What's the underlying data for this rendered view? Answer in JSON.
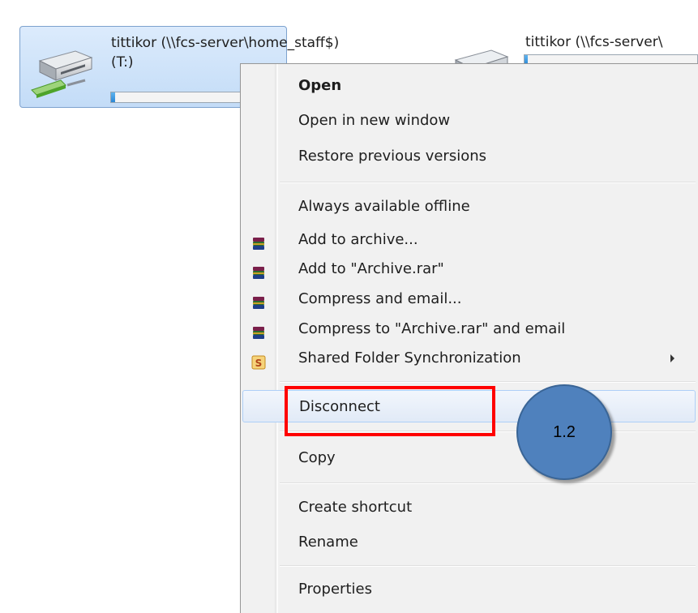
{
  "drives": [
    {
      "name": "tittikor (\\\\fcs-server\\home_staff$)",
      "letter": "(T:)",
      "selected": true,
      "capacity_used_fraction": 0.02
    },
    {
      "name": "tittikor (\\\\fcs-server\\",
      "letter": "",
      "selected": false,
      "capacity_used_fraction": 0.02
    }
  ],
  "context_menu": {
    "items": [
      {
        "label": "Open",
        "bold": true
      },
      {
        "label": "Open in new window"
      },
      {
        "label": "Restore previous versions"
      },
      {
        "label": "Always available offline"
      },
      {
        "label": "Add to archive...",
        "icon": "winrar-icon"
      },
      {
        "label": "Add to \"Archive.rar\"",
        "icon": "winrar-icon"
      },
      {
        "label": "Compress and email...",
        "icon": "winrar-icon"
      },
      {
        "label": "Compress to \"Archive.rar\" and email",
        "icon": "winrar-icon"
      },
      {
        "label": "Shared Folder Synchronization",
        "icon": "sync-icon",
        "submenu": true
      },
      {
        "label": "Disconnect",
        "hover": true
      },
      {
        "label": "Copy"
      },
      {
        "label": "Create shortcut"
      },
      {
        "label": "Rename"
      },
      {
        "label": "Properties"
      }
    ]
  },
  "annotation": {
    "badge_text": "1.2",
    "highlight_color": "#ff0000",
    "badge_color": "#4f81bd"
  }
}
